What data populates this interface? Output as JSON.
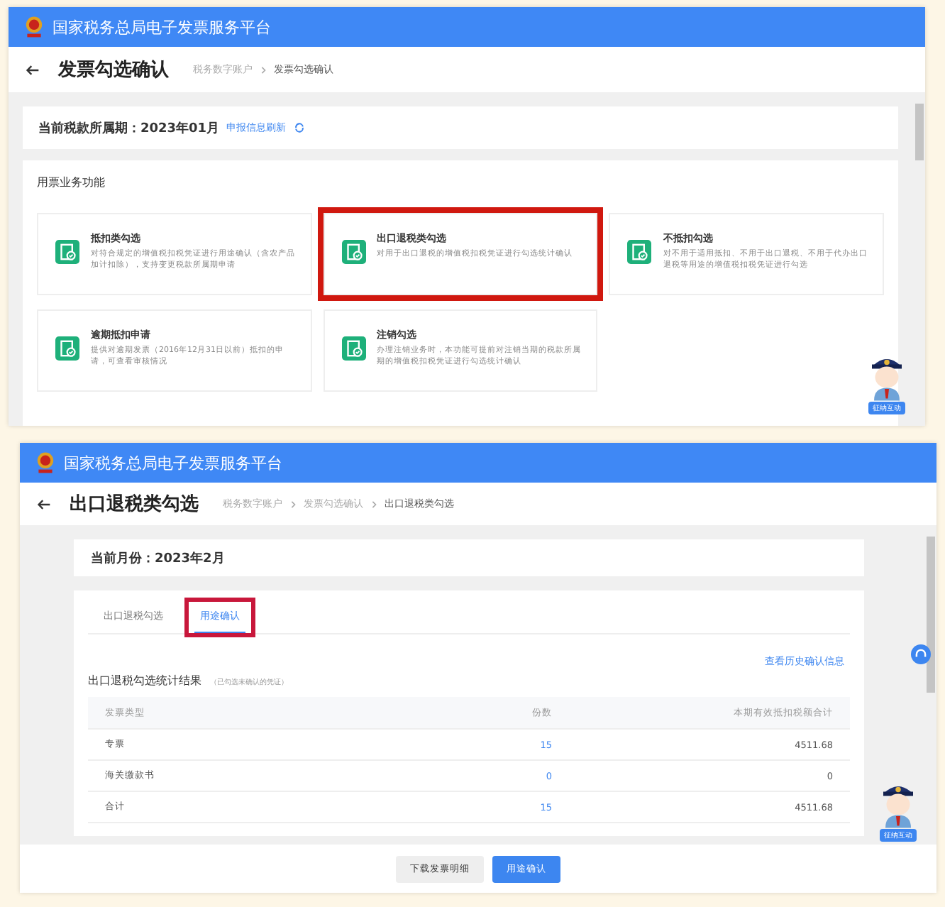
{
  "screen_1": {
    "header": {
      "title": "国家税务总局电子发票服务平台"
    },
    "title_bar": {
      "title": "发票勾选确认",
      "breadcrumb": [
        "税务数字账户",
        "发票勾选确认"
      ]
    },
    "period": {
      "label": "当前税款所属期：2023年01月",
      "refresh_link": "申报信息刷新"
    },
    "functions": {
      "title": "用票业务功能",
      "cards": [
        {
          "title": "抵扣类勾选",
          "description": "对符合规定的增值税扣税凭证进行用途确认（含农产品加计扣除），支持变更税款所属期申请",
          "highlighted": false
        },
        {
          "title": "出口退税类勾选",
          "description": "对用于出口退税的增值税扣税凭证进行勾选统计确认",
          "highlighted": true
        },
        {
          "title": "不抵扣勾选",
          "description": "对不用于适用抵扣、不用于出口退税、不用于代办出口退税等用途的增值税扣税凭证进行勾选",
          "highlighted": false
        },
        {
          "title": "逾期抵扣申请",
          "description": "提供对逾期发票（2016年12月31日以前）抵扣的申请，可查看审核情况",
          "highlighted": false
        },
        {
          "title": "注销勾选",
          "description": "办理注销业务时，本功能可提前对注销当期的税款所属期的增值税扣税凭证进行勾选统计确认",
          "highlighted": false
        }
      ]
    },
    "assistant_badge": "征纳互动"
  },
  "screen_2": {
    "header": {
      "title": "国家税务总局电子发票服务平台"
    },
    "title_bar": {
      "title": "出口退税类勾选",
      "breadcrumb": [
        "税务数字账户",
        "发票勾选确认",
        "出口退税类勾选"
      ]
    },
    "month": {
      "label": "当前月份：2023年2月"
    },
    "tabs": [
      {
        "label": "出口退税勾选",
        "selected": false,
        "highlighted": false
      },
      {
        "label": "用途确认",
        "selected": true,
        "highlighted": true
      }
    ],
    "history_link": "查看历史确认信息",
    "section": {
      "title": "出口退税勾选统计结果",
      "note": "（已勾选未确认的凭证）"
    },
    "table": {
      "columns": [
        "发票类型",
        "份数",
        "本期有效抵扣税额合计"
      ],
      "rows": [
        [
          "专票",
          "15",
          "4511.68"
        ],
        [
          "海关缴款书",
          "0",
          "0"
        ],
        [
          "合计",
          "15",
          "4511.68"
        ]
      ]
    },
    "buttons": [
      {
        "label": "下载发票明细",
        "kind": "secondary"
      },
      {
        "label": "用途确认",
        "kind": "primary"
      }
    ],
    "assistant_badge": "征纳互动"
  }
}
